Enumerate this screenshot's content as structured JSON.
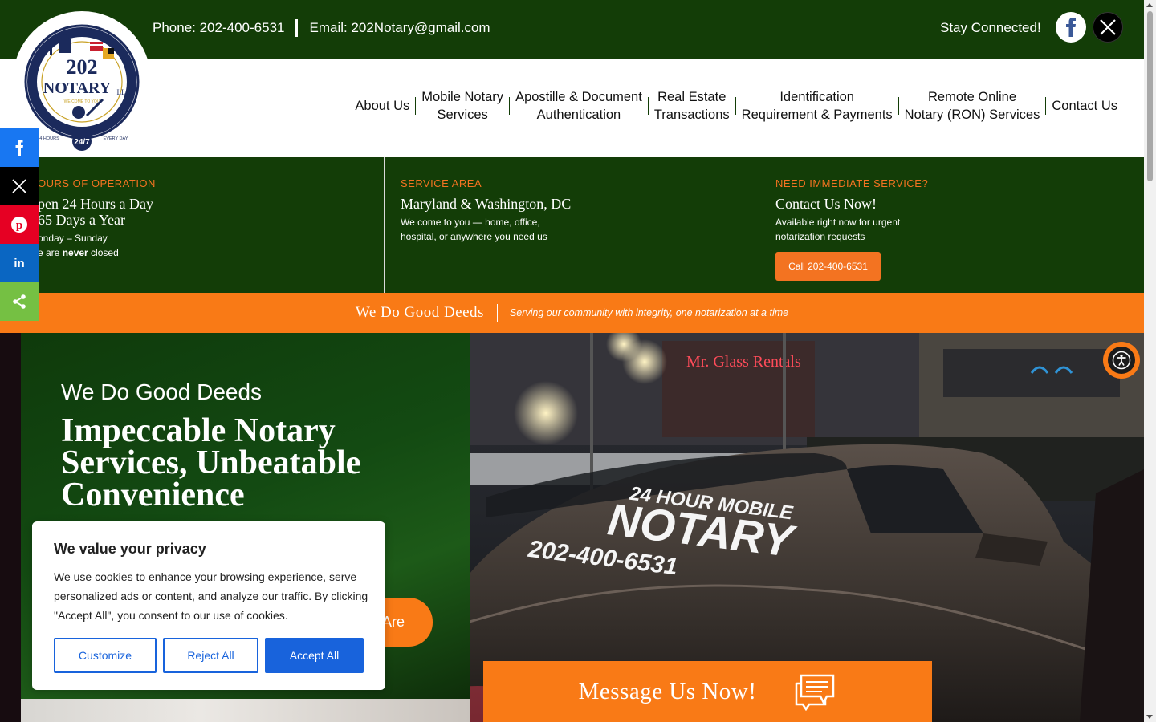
{
  "topbar": {
    "phone": "Phone: 202-400-6531",
    "email": "Email: 202Notary@gmail.com",
    "stay_connected": "Stay Connected!",
    "social_icons": [
      "facebook-icon",
      "x-twitter-icon"
    ]
  },
  "logo": {
    "name": "202",
    "line2": "NOTARY",
    "llc": "LLC",
    "tagline": "WE COME TO YOU",
    "ring_text": "WASHINGTON DC & MARYLAND",
    "hours_left": "24 HOURS",
    "badge": "24/7",
    "hours_right": "EVERY DAY"
  },
  "nav": {
    "items": [
      {
        "line1": "About Us",
        "line2": ""
      },
      {
        "line1": "Mobile Notary",
        "line2": "Services"
      },
      {
        "line1": "Apostille & Document",
        "line2": "Authentication"
      },
      {
        "line1": "Real Estate",
        "line2": "Transactions"
      },
      {
        "line1": "Identification",
        "line2": "Requirement & Payments"
      },
      {
        "line1": "Remote Online",
        "line2": "Notary (RON) Services"
      },
      {
        "line1": "Contact Us",
        "line2": ""
      }
    ]
  },
  "info": {
    "hours": {
      "label": "OURS OF OPERATION",
      "line1": "pen 24 Hours a Day",
      "line2": "65 Days a Year",
      "sub1": "onday – Sunday",
      "sub2_pre": "e are ",
      "sub2_bold": "never",
      "sub2_post": " closed"
    },
    "area": {
      "label": "SERVICE AREA",
      "head": "Maryland & Washington, DC",
      "sub1": "We come to you — home, office,",
      "sub2": "hospital, or anywhere you need us"
    },
    "immediate": {
      "label": "NEED IMMEDIATE SERVICE?",
      "head": "Contact Us Now!",
      "sub1": "Available right now for urgent",
      "sub2": "notarization requests",
      "button": "Call 202-400-6531"
    }
  },
  "banner": {
    "title": "We Do Good Deeds",
    "subtitle": "Serving our community with integrity, one notarization at a time"
  },
  "hero": {
    "kicker": "We Do Good Deeds",
    "headline": "Impeccable Notary Services, Unbeatable Convenience",
    "cta_partial": "Are",
    "photo": {
      "sign": "Mr. Glass Rentals",
      "car_line1": "24 HOUR MOBILE",
      "car_line2": "NOTARY",
      "car_line3": "202-400-6531"
    }
  },
  "share": {
    "items": [
      {
        "icon": "facebook-icon",
        "glyph": "f",
        "color": "#1877f2"
      },
      {
        "icon": "x-twitter-icon",
        "glyph": "𝕏",
        "color": "#000000"
      },
      {
        "icon": "pinterest-icon",
        "glyph": "P",
        "color": "#e60023"
      },
      {
        "icon": "linkedin-icon",
        "glyph": "in",
        "color": "#0a66c2"
      },
      {
        "icon": "share-icon",
        "glyph": "<",
        "color": "#75c043"
      }
    ]
  },
  "message": {
    "label": "Message Us Now!",
    "icon": "chat-bubbles-icon"
  },
  "accessibility": {
    "icon": "accessibility-icon"
  },
  "cookie": {
    "title": "We value your privacy",
    "body": "We use cookies to enhance your browsing experience, serve personalized ads or content, and analyze our traffic. By clicking \"Accept All\", you consent to our use of cookies.",
    "customize": "Customize",
    "reject": "Reject All",
    "accept": "Accept All"
  },
  "colors": {
    "brand_green": "#133d07",
    "brand_orange": "#f97a16",
    "cookie_blue": "#1863dc"
  }
}
